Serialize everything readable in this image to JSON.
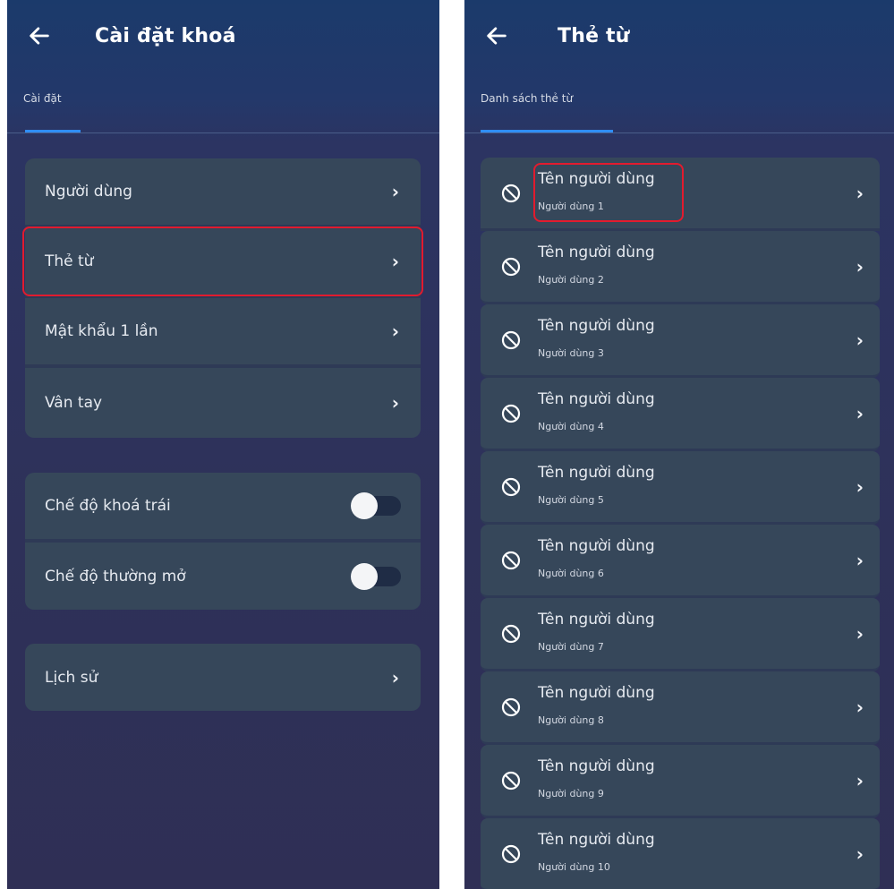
{
  "left": {
    "title": "Cài đặt khoá",
    "tab": "Cài đặt",
    "groups": [
      {
        "items": [
          "Người dùng",
          "Thẻ từ",
          "Mật khẩu 1 lần",
          "Vân tay"
        ]
      },
      {
        "toggles": [
          {
            "label": "Chế độ khoá trái",
            "on": false
          },
          {
            "label": "Chế độ thường mở",
            "on": false
          }
        ]
      },
      {
        "items": [
          "Lịch sử"
        ]
      }
    ],
    "chevron": "›"
  },
  "right": {
    "title": "Thẻ từ",
    "tab": "Danh sách thẻ từ",
    "items": [
      {
        "title": "Tên người dùng",
        "subtitle": "Người dùng 1"
      },
      {
        "title": "Tên người dùng",
        "subtitle": "Người dùng 2"
      },
      {
        "title": "Tên người dùng",
        "subtitle": "Người dùng 3"
      },
      {
        "title": "Tên người dùng",
        "subtitle": "Người dùng 4"
      },
      {
        "title": "Tên người dùng",
        "subtitle": "Người dùng 5"
      },
      {
        "title": "Tên người dùng",
        "subtitle": "Người dùng 6"
      },
      {
        "title": "Tên người dùng",
        "subtitle": "Người dùng 7"
      },
      {
        "title": "Tên người dùng",
        "subtitle": "Người dùng 8"
      },
      {
        "title": "Tên người dùng",
        "subtitle": "Người dùng 9"
      },
      {
        "title": "Tên người dùng",
        "subtitle": "Người dùng 10"
      }
    ],
    "chevron": "›"
  },
  "colors": {
    "highlight": "#e21b2e",
    "accent": "#2f8ef5",
    "card": "#36475a"
  },
  "icons": {
    "back": "arrow-left-icon",
    "ban": "ban-icon",
    "chevron": "chevron-right-icon"
  }
}
